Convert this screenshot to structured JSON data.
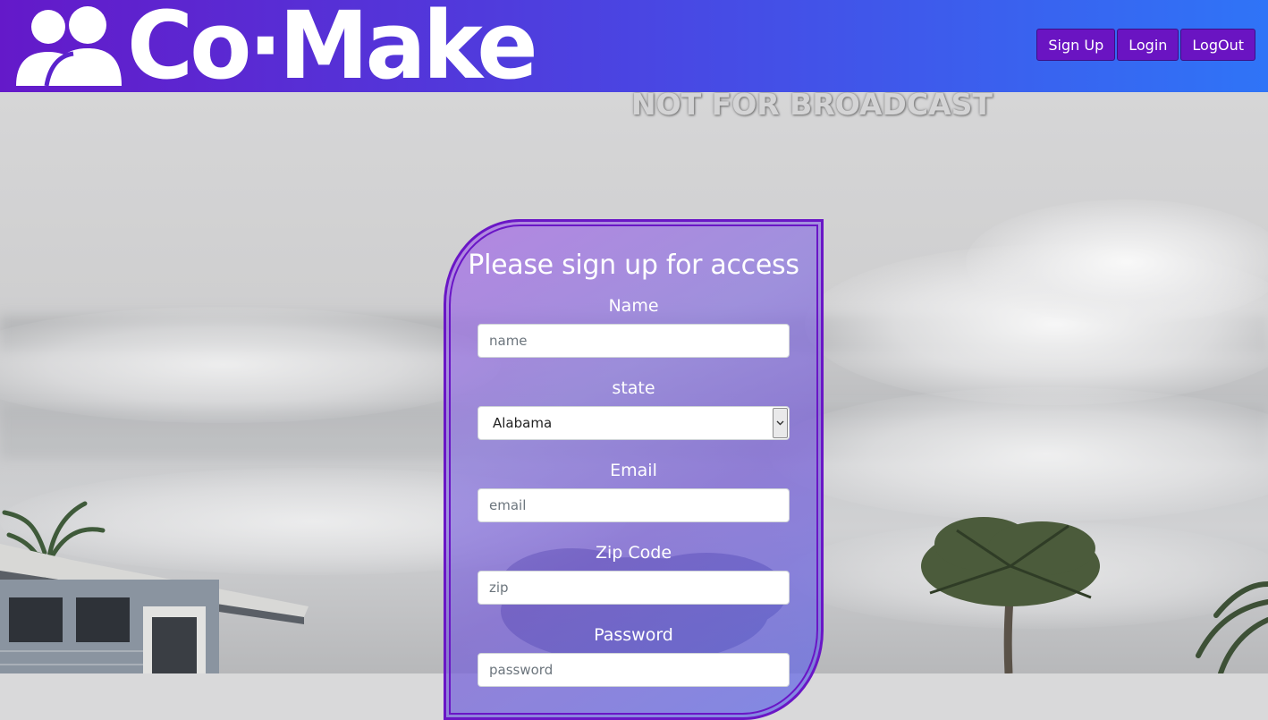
{
  "header": {
    "brand": "Co·Make",
    "nav": {
      "signup_label": "Sign Up",
      "login_label": "Login",
      "logout_label": "LogOut"
    }
  },
  "background": {
    "overlay_text": "NOT FOR BROADCAST"
  },
  "form": {
    "title": "Please sign up for access",
    "name": {
      "label": "Name",
      "placeholder": "name",
      "value": ""
    },
    "state": {
      "label": "state",
      "selected": "Alabama"
    },
    "email": {
      "label": "Email",
      "placeholder": "email",
      "value": ""
    },
    "zip": {
      "label": "Zip Code",
      "placeholder": "zip",
      "value": ""
    },
    "password": {
      "label": "Password",
      "placeholder": "password",
      "value": ""
    }
  },
  "colors": {
    "header_start": "#6419c9",
    "header_end": "#2f74f7",
    "button": "#6a14c2",
    "card_border": "#6a16c6"
  }
}
